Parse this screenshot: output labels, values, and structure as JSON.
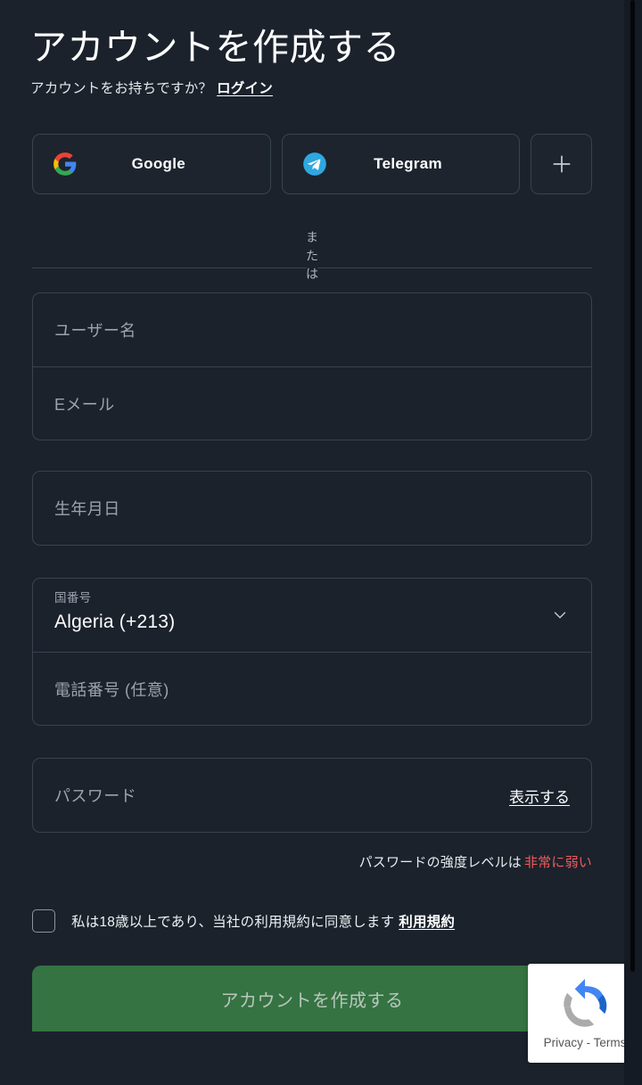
{
  "header": {
    "title": "アカウントを作成する",
    "have_account": "アカウントをお持ちですか？",
    "login_link": "ログイン"
  },
  "social": {
    "google_label": "Google",
    "telegram_label": "Telegram",
    "more_label": "+"
  },
  "divider": {
    "or": "または"
  },
  "form": {
    "username_placeholder": "ユーザー名",
    "email_placeholder": "Eメール",
    "birthdate_placeholder": "生年月日",
    "country_code_label": "国番号",
    "country_code_value": "Algeria (+213)",
    "phone_placeholder": "電話番号 (任意)",
    "password_placeholder": "パスワード",
    "password_show": "表示する",
    "strength_label": "パスワードの強度レベルは",
    "strength_value": "非常に弱い"
  },
  "terms": {
    "checkbox_text": "私は18歳以上であり、当社の利用規約に同意します",
    "tos_link": "利用規約"
  },
  "submit": {
    "label": "アカウントを作成する"
  },
  "recaptcha": {
    "text": "Privacy - Terms"
  },
  "colors": {
    "background": "#1b222c",
    "field_border": "#39424f",
    "accent_green": "#357342",
    "strength_red": "#ef5a5a",
    "telegram_blue": "#2fa7e0"
  }
}
